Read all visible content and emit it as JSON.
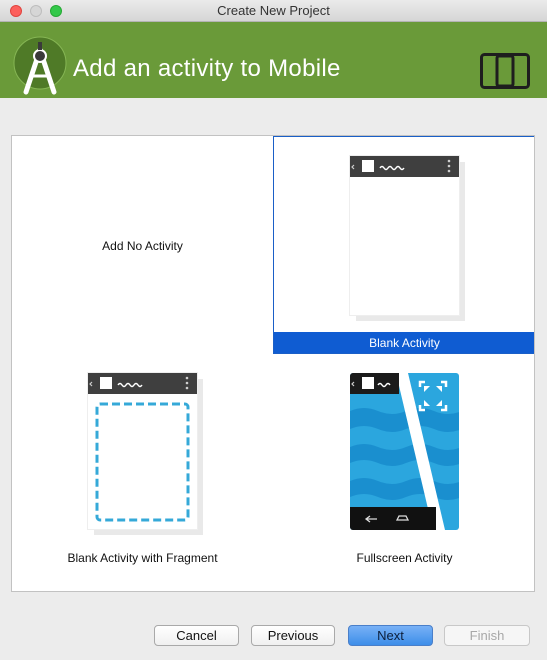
{
  "window": {
    "title": "Create New Project"
  },
  "header": {
    "title": "Add an activity to Mobile",
    "logo": "android-studio-logo",
    "device_icon": "phone-tablet-icon",
    "brand_color": "#6a9a39"
  },
  "gallery": {
    "items": [
      {
        "label": "Add No Activity",
        "selected": false
      },
      {
        "label": "Blank Activity",
        "selected": true
      },
      {
        "label": "Blank Activity with Fragment",
        "selected": false
      },
      {
        "label": "Fullscreen Activity",
        "selected": false
      }
    ],
    "selection_color": "#0f5cd2"
  },
  "footer": {
    "cancel": "Cancel",
    "previous": "Previous",
    "next": "Next",
    "finish": "Finish"
  }
}
